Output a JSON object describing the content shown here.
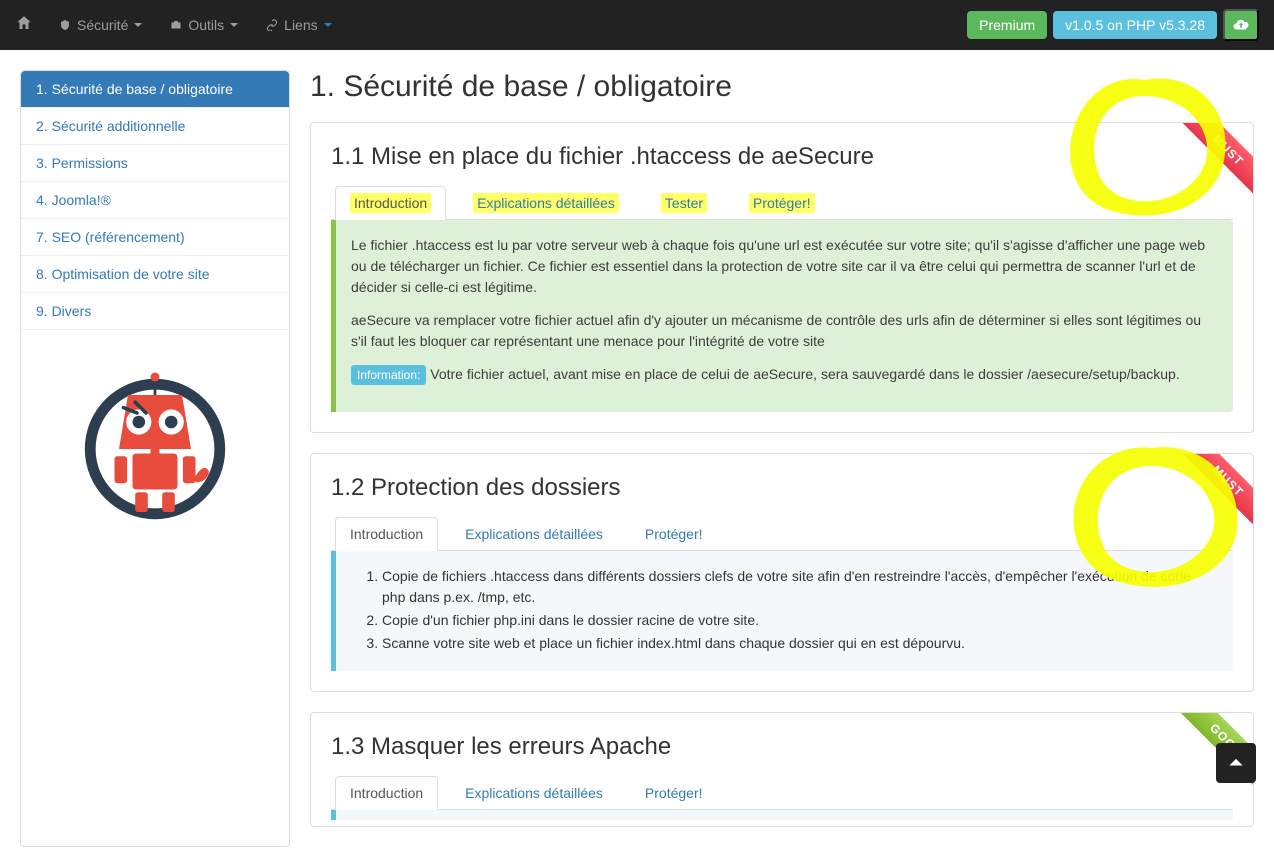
{
  "navbar": {
    "menu": {
      "securite": "Sécurité",
      "outils": "Outils",
      "liens": "Liens"
    },
    "premium": "Premium",
    "version": "v1.0.5 on PHP v5.3.28"
  },
  "sidebar": {
    "items": [
      {
        "label": "1. Sécurité de base / obligatoire",
        "active": true
      },
      {
        "label": "2. Sécurité additionnelle"
      },
      {
        "label": "3. Permissions"
      },
      {
        "label": "4. Joomla!®"
      },
      {
        "label": "7. SEO (référencement)"
      },
      {
        "label": "8. Optimisation de votre site"
      },
      {
        "label": "9. Divers"
      }
    ]
  },
  "section": {
    "title": "1. Sécurité de base / obligatoire"
  },
  "panels": [
    {
      "title": "1.1 Mise en place du fichier .htaccess de aeSecure",
      "ribbon": "MUST",
      "tabs": [
        "Introduction",
        "Explications détaillées",
        "Tester",
        "Protéger!"
      ],
      "body": {
        "p1": "Le fichier .htaccess est lu par votre serveur web à chaque fois qu'une url est exécutée sur votre site; qu'il s'agisse d'afficher une page web ou de télécharger un fichier. Ce fichier est essentiel dans la protection de votre site car il va être celui qui permettra de scanner l'url et de décider si celle-ci est légitime.",
        "p2": "aeSecure va remplacer votre fichier actuel afin d'y ajouter un mécanisme de contrôle des urls afin de déterminer si elles sont légitimes ou s'il faut les bloquer car représentant une menace pour l'intégrité de votre site",
        "info_label": "Information:",
        "info_text": " Votre fichier actuel, avant mise en place de celui de aeSecure, sera sauvegardé dans le dossier /aesecure/setup/backup."
      }
    },
    {
      "title": "1.2 Protection des dossiers",
      "ribbon": "MUST",
      "tabs": [
        "Introduction",
        "Explications détaillées",
        "Protéger!"
      ],
      "list": [
        "Copie de fichiers .htaccess dans différents dossiers clefs de votre site afin d'en restreindre l'accès, d'empêcher l'exécution de code php dans p.ex. /tmp, etc.",
        "Copie d'un fichier php.ini dans le dossier racine de votre site.",
        "Scanne votre site web et place un fichier index.html dans chaque dossier qui en est dépourvu."
      ]
    },
    {
      "title": "1.3 Masquer les erreurs Apache",
      "ribbon": "GOOD",
      "tabs": [
        "Introduction",
        "Explications détaillées",
        "Protéger!"
      ]
    }
  ]
}
